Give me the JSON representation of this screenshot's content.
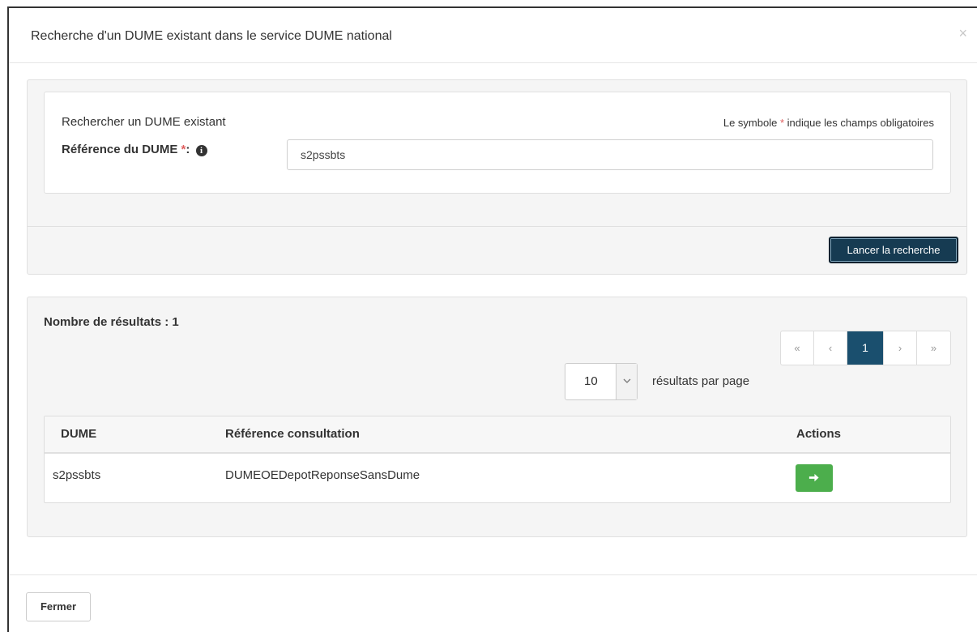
{
  "modal": {
    "title": "Recherche d'un DUME existant dans le service DUME national",
    "close_symbol": "×"
  },
  "search": {
    "heading": "Rechercher un DUME existant",
    "required_note_prefix": "Le symbole ",
    "required_star": "*",
    "required_note_suffix": " indique les champs obligatoires",
    "field_label": "Référence du DUME ",
    "field_star": "*",
    "field_colon": ":",
    "info_symbol": "i",
    "field_value": "s2pssbts",
    "search_button": "Lancer la recherche"
  },
  "results": {
    "count_label": "Nombre de résultats : 1",
    "pagination": [
      "«",
      "‹",
      "1",
      "›",
      "»"
    ],
    "active_page": "1",
    "per_page_value": "10",
    "per_page_label": "résultats par page",
    "columns": [
      "DUME",
      "Référence consultation",
      "Actions"
    ],
    "rows": [
      {
        "dume": "s2pssbts",
        "reference": "DUMEOEDepotReponseSansDume"
      }
    ]
  },
  "footer": {
    "close_button": "Fermer"
  },
  "icons": {
    "info": "info-circle-icon",
    "arrow": "arrow-right-icon",
    "caret": "chevron-down-icon"
  },
  "colors": {
    "primary": "#163b52",
    "active_page": "#1a4f6e",
    "success": "#4cae4c",
    "required": "#e06060"
  }
}
